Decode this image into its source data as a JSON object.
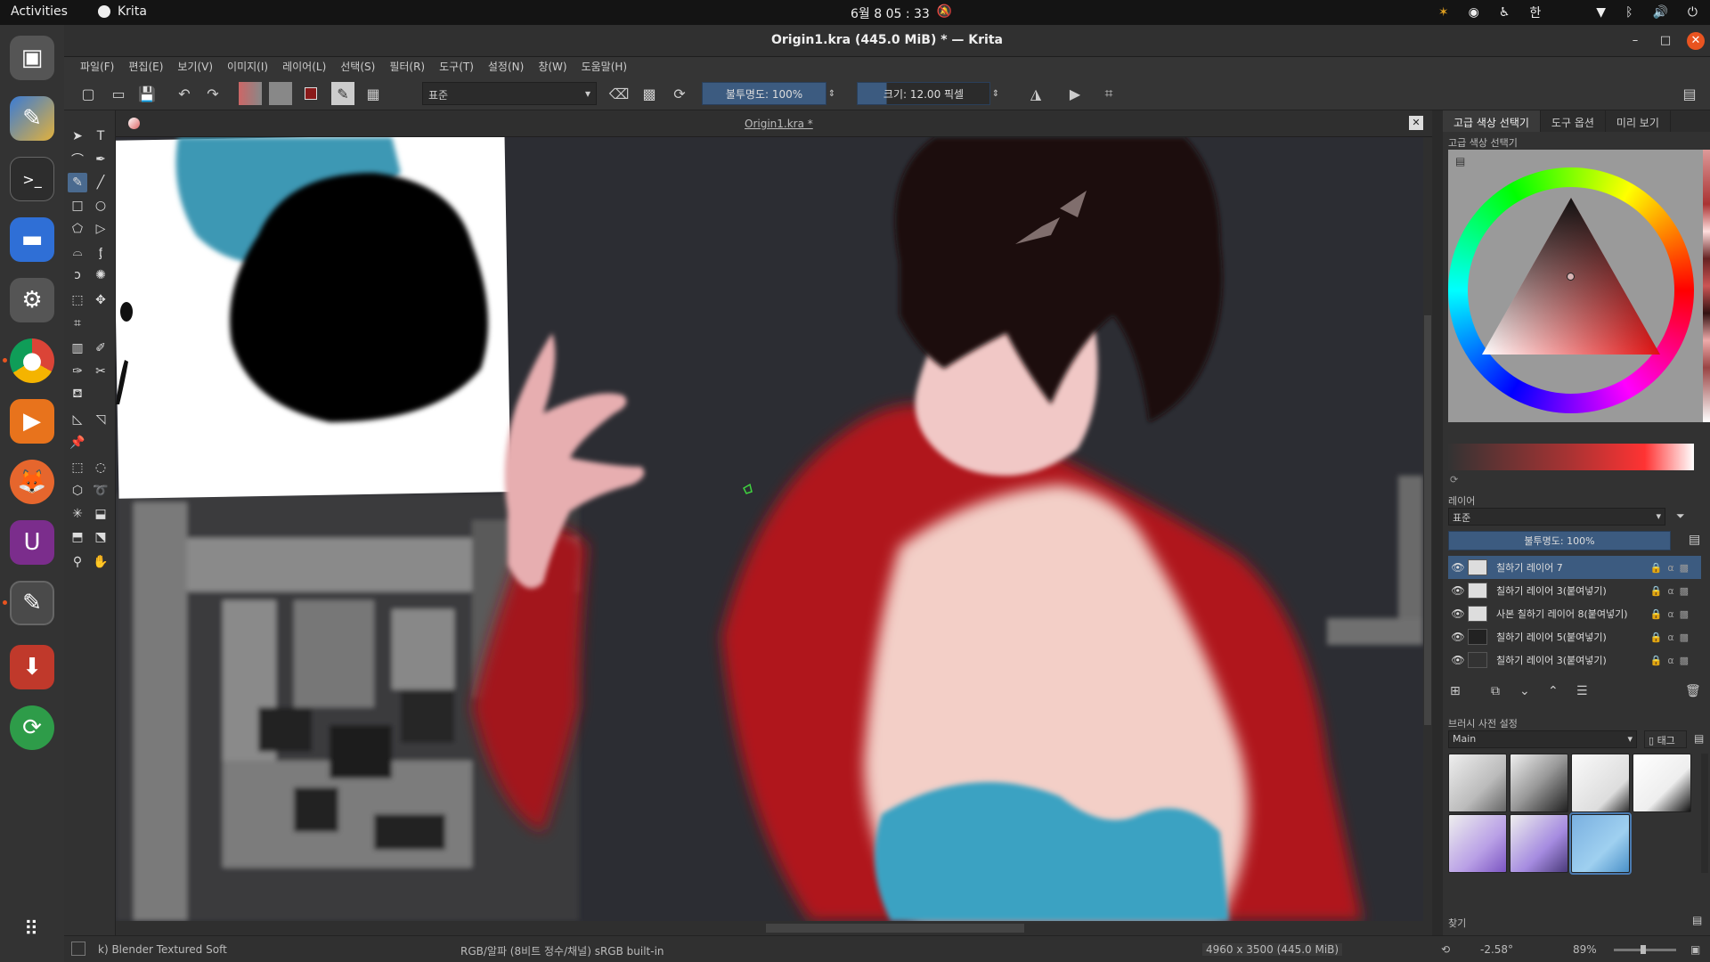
{
  "topbar": {
    "activities": "Activities",
    "app_name": "Krita",
    "clock": "6월 8 05 : 33",
    "input_method": "한"
  },
  "window": {
    "title": "Origin1.kra (445.0 MiB)  * — Krita"
  },
  "menu": [
    "파일(F)",
    "편집(E)",
    "보기(V)",
    "이미지(I)",
    "레이어(L)",
    "선택(S)",
    "필터(R)",
    "도구(T)",
    "설정(N)",
    "창(W)",
    "도움말(H)"
  ],
  "toolbar": {
    "blend_mode": "표준",
    "opacity": "불투명도: 100%",
    "size": "크기: 12.00 픽셀"
  },
  "document": {
    "tab_title": "Origin1.kra *"
  },
  "right_panel": {
    "tabs": [
      "고급 색상 선택기",
      "도구 옵션",
      "미리 보기"
    ],
    "color_selector_title": "고급 색상 선택기",
    "layers_title": "레이어",
    "layer_blend_mode": "표준",
    "layer_opacity": "불투명도: 100%",
    "layers": [
      {
        "name": "칠하기 레이어 7",
        "active": true
      },
      {
        "name": "칠하기 레이어 3(붙여넣기)",
        "active": false
      },
      {
        "name": "사본 칠하기 레이어 8(붙여넣기)",
        "active": false
      },
      {
        "name": "칠하기 레이어 5(붙여넣기)",
        "active": false
      },
      {
        "name": "칠하기 레이어 3(붙여넣기)",
        "active": false
      }
    ],
    "brush_presets_title": "브러시 사전 설정",
    "brush_group": "Main",
    "brush_tag": "태그",
    "search_label": "찾기"
  },
  "status": {
    "brush": "k) Blender Textured Soft",
    "color_space": "RGB/알파 (8비트 정수/채널)  sRGB built-in",
    "image_size": "4960 x 3500 (445.0 MiB)",
    "rotation": "-2.58°",
    "zoom": "89%"
  }
}
